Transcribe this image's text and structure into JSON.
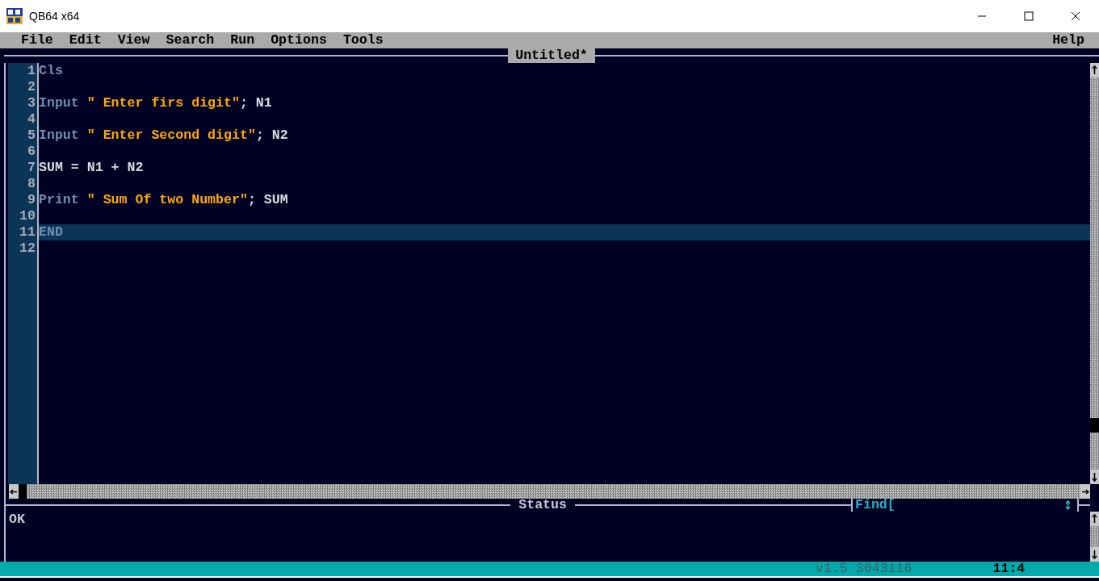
{
  "window": {
    "title": "QB64 x64"
  },
  "menu": [
    {
      "label": "File"
    },
    {
      "label": "Edit"
    },
    {
      "label": "View"
    },
    {
      "label": "Search"
    },
    {
      "label": "Run"
    },
    {
      "label": "Options"
    },
    {
      "label": "Tools"
    }
  ],
  "help_menu": {
    "label": "Help"
  },
  "editor": {
    "title": "Untitled*",
    "lines": [
      {
        "number": "1",
        "selected": false,
        "tokens": [
          {
            "kind": "keyword",
            "text": "Cls"
          }
        ]
      },
      {
        "number": "2",
        "selected": false
      },
      {
        "number": "3",
        "selected": false,
        "tokens": [
          {
            "kind": "keyword",
            "text": "Input "
          },
          {
            "kind": "string",
            "text": "\" Enter firs digit\""
          },
          {
            "kind": "plain",
            "text": "; N1"
          }
        ]
      },
      {
        "number": "4",
        "selected": false
      },
      {
        "number": "5",
        "selected": false,
        "tokens": [
          {
            "kind": "keyword",
            "text": "Input "
          },
          {
            "kind": "string",
            "text": "\" Enter Second digit\""
          },
          {
            "kind": "plain",
            "text": "; N2"
          }
        ]
      },
      {
        "number": "6",
        "selected": false
      },
      {
        "number": "7",
        "selected": false,
        "tokens": [
          {
            "kind": "plain",
            "text": "SUM = N1 + N2"
          }
        ]
      },
      {
        "number": "8",
        "selected": false
      },
      {
        "number": "9",
        "selected": false,
        "tokens": [
          {
            "kind": "keyword",
            "text": "Print "
          },
          {
            "kind": "string",
            "text": "\" Sum Of two Number\""
          },
          {
            "kind": "plain",
            "text": "; SUM"
          }
        ]
      },
      {
        "number": "10",
        "selected": false
      },
      {
        "number": "11",
        "selected": true,
        "tokens": [
          {
            "kind": "keyword",
            "text": "END"
          }
        ]
      },
      {
        "number": "12",
        "selected": false
      }
    ]
  },
  "status_panel": {
    "title": "Status",
    "message": "OK"
  },
  "find": {
    "label": "Find["
  },
  "status_bar": {
    "version": "v1.5 3043116",
    "position": "11:4"
  }
}
